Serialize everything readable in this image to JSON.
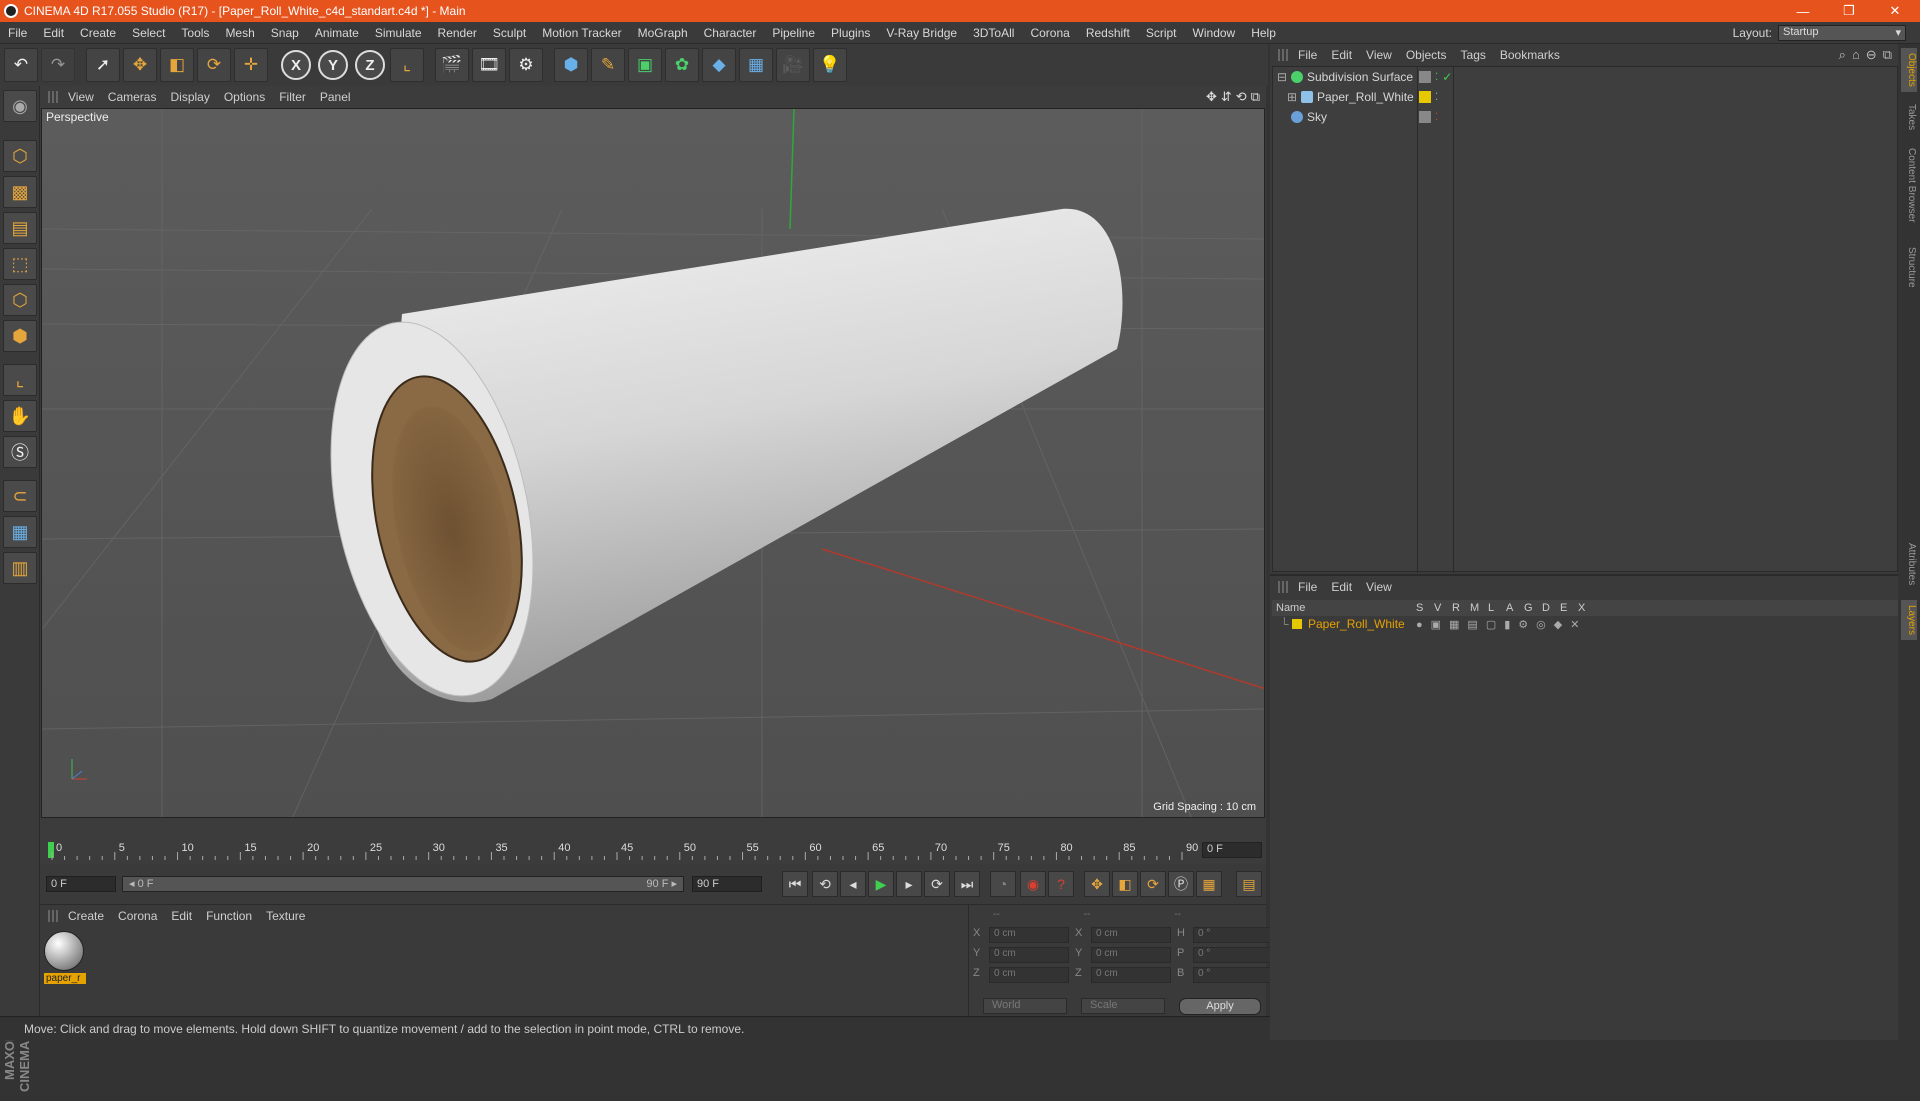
{
  "window": {
    "title": "CINEMA 4D R17.055 Studio (R17) - [Paper_Roll_White_c4d_standart.c4d *] - Main",
    "controls": [
      "—",
      "❐",
      "✕"
    ]
  },
  "menubar": {
    "items": [
      "File",
      "Edit",
      "Create",
      "Select",
      "Tools",
      "Mesh",
      "Snap",
      "Animate",
      "Simulate",
      "Render",
      "Sculpt",
      "Motion Tracker",
      "MoGraph",
      "Character",
      "Pipeline",
      "Plugins",
      "V-Ray Bridge",
      "3DToAll",
      "Corona",
      "Redshift",
      "Script",
      "Window",
      "Help"
    ],
    "layout_label": "Layout:",
    "layout_value": "Startup"
  },
  "viewport": {
    "menu": [
      "View",
      "Cameras",
      "Display",
      "Options",
      "Filter",
      "Panel"
    ],
    "label": "Perspective",
    "grid_spacing": "Grid Spacing : 10 cm"
  },
  "timeline": {
    "ticks": [
      "0",
      "5",
      "10",
      "15",
      "20",
      "25",
      "30",
      "35",
      "40",
      "45",
      "50",
      "55",
      "60",
      "65",
      "70",
      "75",
      "80",
      "85",
      "90"
    ],
    "end_field": "0 F"
  },
  "transport": {
    "current_frame": "0 F",
    "slider_start": "◂ 0 F",
    "slider_end": "90 F ▸",
    "end_frame": "90 F"
  },
  "material_panel": {
    "menu": [
      "Create",
      "Corona",
      "Edit",
      "Function",
      "Texture"
    ],
    "material_name": "paper_r"
  },
  "coordinates": {
    "header_dashes": [
      "--",
      "--",
      "--"
    ],
    "rows": [
      {
        "a": "X",
        "v1": "0 cm",
        "b": "X",
        "v2": "0 cm",
        "c": "H",
        "v3": "0 °"
      },
      {
        "a": "Y",
        "v1": "0 cm",
        "b": "Y",
        "v2": "0 cm",
        "c": "P",
        "v3": "0 °"
      },
      {
        "a": "Z",
        "v1": "0 cm",
        "b": "Z",
        "v2": "0 cm",
        "c": "B",
        "v3": "0 °"
      }
    ],
    "mode1": "World",
    "mode2": "Scale",
    "apply": "Apply"
  },
  "status": {
    "text": "Move: Click and drag to move elements. Hold down SHIFT to quantize movement / add to the selection in point mode, CTRL to remove."
  },
  "object_manager": {
    "menu": [
      "File",
      "Edit",
      "View",
      "Objects",
      "Tags",
      "Bookmarks"
    ],
    "objects": [
      {
        "name": "Subdivision Surface",
        "icon_color": "#4bd06a"
      },
      {
        "name": "Paper_Roll_White",
        "icon_color": "#8fc1e8"
      },
      {
        "name": "Sky",
        "icon_color": "#6a9fd8"
      }
    ]
  },
  "layer_manager": {
    "menu": [
      "File",
      "Edit",
      "View"
    ],
    "columns": [
      "Name",
      "S",
      "V",
      "R",
      "M",
      "L",
      "A",
      "G",
      "D",
      "E",
      "X"
    ],
    "layer_name": "Paper_Roll_White",
    "layer_color": "#e6c800"
  },
  "side_tabs": [
    "Objects",
    "Takes",
    "Content Browser",
    "Structure",
    "Attributes",
    "Layers"
  ],
  "colors": {
    "accent": "#e6531d",
    "selection": "#e6a200"
  }
}
